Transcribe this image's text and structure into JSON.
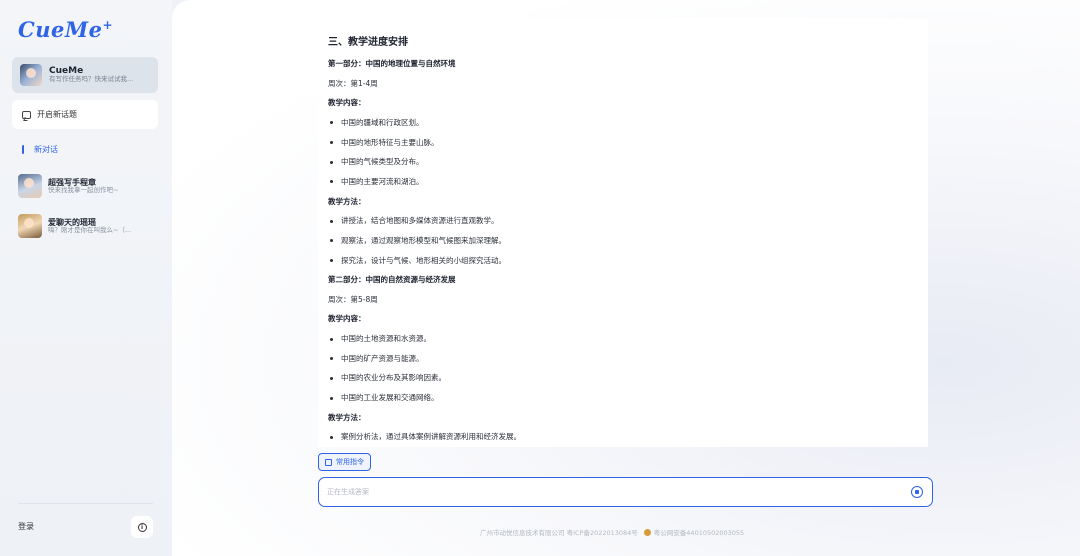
{
  "sidebar": {
    "logo": "CueMe",
    "logo_mark": "+",
    "agent": {
      "name": "CueMe",
      "desc": "有写作任务吗？快来试试我..."
    },
    "new_topic": "开启新话题",
    "new_chat": "新对话",
    "history": [
      {
        "name": "超强写手程章",
        "desc": "快来找我拿一起创作吧~"
      },
      {
        "name": "爱聊天的瑶瑶",
        "desc": "嗨？刚才是你在叫我么~（..."
      }
    ],
    "login": "登录",
    "info_icon": "info-icon"
  },
  "content": {
    "section_title": "三、教学进度安排",
    "lines": [
      {
        "t": "第一部分：中国的地理位置与自然环境",
        "k": "b"
      },
      {
        "t": "周次：第1-4周",
        "k": "p"
      },
      {
        "t": "教学内容：",
        "k": "b"
      },
      {
        "t": "中国的疆域和行政区划。",
        "k": "li"
      },
      {
        "t": "中国的地形特征与主要山脉。",
        "k": "li"
      },
      {
        "t": "中国的气候类型及分布。",
        "k": "li"
      },
      {
        "t": "中国的主要河流和湖泊。",
        "k": "li"
      },
      {
        "t": "教学方法：",
        "k": "b"
      },
      {
        "t": "讲授法，结合地图和多媒体资源进行直观教学。",
        "k": "li"
      },
      {
        "t": "观察法，通过观察地形模型和气候图来加深理解。",
        "k": "li"
      },
      {
        "t": "探究法，设计与气候、地形相关的小组探究活动。",
        "k": "li"
      },
      {
        "t": "第二部分：中国的自然资源与经济发展",
        "k": "b"
      },
      {
        "t": "周次：第5-8周",
        "k": "p"
      },
      {
        "t": "教学内容：",
        "k": "b"
      },
      {
        "t": "中国的土地资源和水资源。",
        "k": "li"
      },
      {
        "t": "中国的矿产资源与能源。",
        "k": "li"
      },
      {
        "t": "中国的农业分布及其影响因素。",
        "k": "li"
      },
      {
        "t": "中国的工业发展和交通网络。",
        "k": "li"
      },
      {
        "t": "教学方法：",
        "k": "b"
      },
      {
        "t": "案例分析法，通过具体案例讲解资源利用和经济发展。",
        "k": "li"
      }
    ]
  },
  "composer": {
    "command_label": "常用指令",
    "placeholder": "正在生成答案"
  },
  "footer": {
    "company": "广州市动悦信息技术有限公司 粤ICP备2022013084号",
    "police": "粤公网安备44010502003055"
  },
  "colors": {
    "accent": "#2f63e8"
  }
}
